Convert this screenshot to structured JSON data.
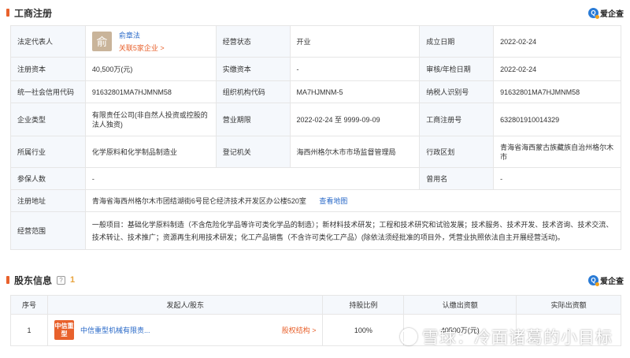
{
  "registration": {
    "title": "工商注册",
    "brand": "爱企查",
    "legal_rep_label": "法定代表人",
    "legal_rep_avatar": "俞",
    "legal_rep_name": "俞章法",
    "legal_rep_link": "关联5家企业 >",
    "status_label": "经营状态",
    "status_value": "开业",
    "founded_label": "成立日期",
    "founded_value": "2022-02-24",
    "capital_label": "注册资本",
    "capital_value": "40,500万(元)",
    "paid_capital_label": "实缴资本",
    "paid_capital_value": "-",
    "approval_label": "审核/年检日期",
    "approval_value": "2022-02-24",
    "credit_code_label": "统一社会信用代码",
    "credit_code_value": "91632801MA7HJMNM58",
    "org_code_label": "组织机构代码",
    "org_code_value": "MA7HJMNM-5",
    "taxpayer_label": "纳税人识别号",
    "taxpayer_value": "91632801MA7HJMNM58",
    "type_label": "企业类型",
    "type_value": "有限责任公司(非自然人投资或控股的法人独资)",
    "term_label": "营业期限",
    "term_value": "2022-02-24 至 9999-09-09",
    "reg_no_label": "工商注册号",
    "reg_no_value": "632801910014329",
    "industry_label": "所属行业",
    "industry_value": "化学原料和化学制品制造业",
    "authority_label": "登记机关",
    "authority_value": "海西州格尔木市市场监督管理局",
    "region_label": "行政区划",
    "region_value": "青海省海西蒙古族藏族自治州格尔木市",
    "insured_label": "参保人数",
    "insured_value": "-",
    "former_name_label": "曾用名",
    "former_name_value": "-",
    "address_label": "注册地址",
    "address_value": "青海省海西州格尔木市团结湖街6号昆仑经济技术开发区办公楼520室",
    "map_link": "查看地图",
    "scope_label": "经营范围",
    "scope_value": "一般项目：基础化学原料制造（不含危险化学品等许可类化学品的制造）；新材料技术研发；工程和技术研究和试验发展；技术服务、技术开发、技术咨询、技术交流、技术转让、技术推广；资源再生利用技术研发；化工产品销售（不含许可类化工产品）(除依法须经批准的项目外，凭营业执照依法自主开展经营活动)。"
  },
  "shareholders": {
    "title": "股东信息",
    "info_icon": "?",
    "count": "1",
    "brand": "爱企查",
    "headers": [
      "序号",
      "发起人/股东",
      "持股比例",
      "认缴出资额",
      "实际出资额"
    ],
    "rows": [
      {
        "index": "1",
        "logo_text": "中信重型",
        "name": "中信重型机械有限责...",
        "link": "股权结构 >",
        "ratio": "100%",
        "subscribed": "40500万(元)",
        "actual": "-"
      }
    ]
  },
  "watermark": "雪球：冷面诸葛的小目标"
}
